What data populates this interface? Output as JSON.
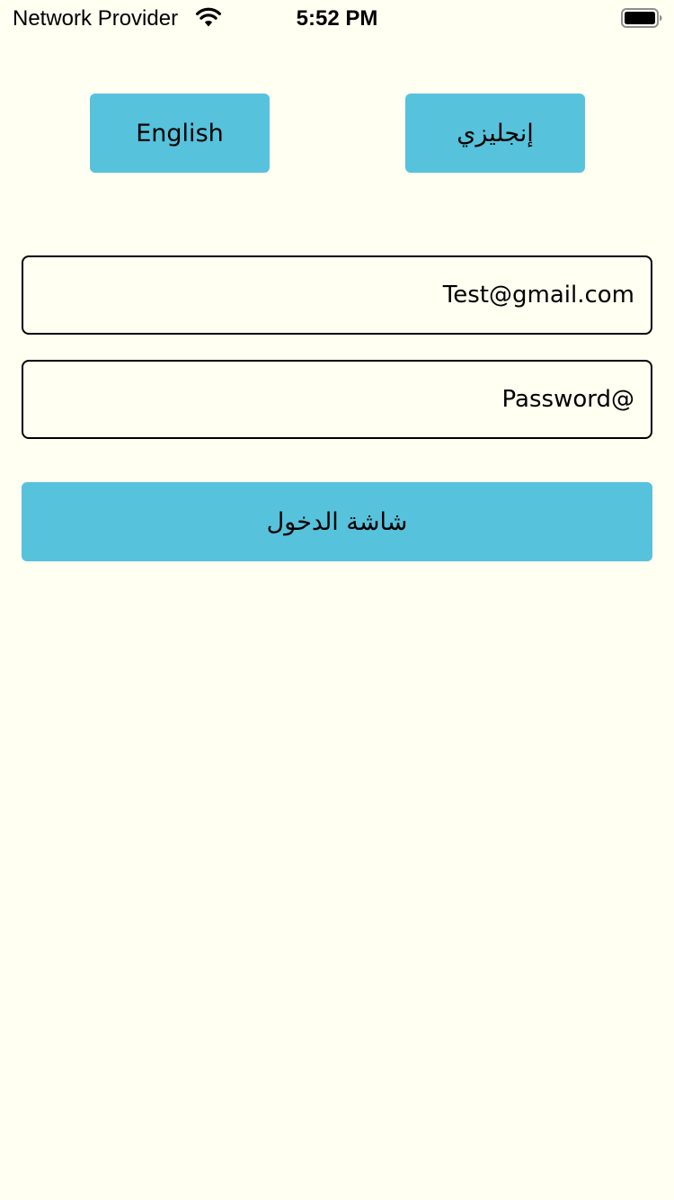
{
  "status_bar": {
    "carrier": "Network Provider",
    "time": "5:52 PM",
    "wifi_icon": "wifi-icon",
    "battery_icon": "battery-full-icon"
  },
  "language_buttons": {
    "english_label": "English",
    "arabic_label": "إنجليزي"
  },
  "form": {
    "email_value": "Test@gmail.com",
    "password_value": "Password@"
  },
  "login_button": {
    "label": "شاشة الدخول"
  },
  "colors": {
    "background": "#FFFFF2",
    "accent": "#57C2DB",
    "border": "#000000"
  }
}
